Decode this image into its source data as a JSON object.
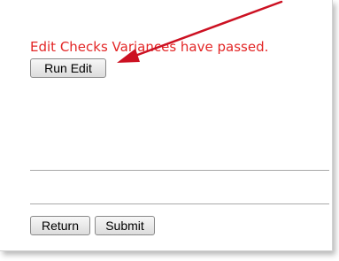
{
  "status_message": "Edit Checks Variances have passed.",
  "buttons": {
    "run_edit": "Run Edit",
    "return": "Return",
    "submit": "Submit"
  },
  "colors": {
    "status_text": "#e32626",
    "annotation_arrow": "#cc1122"
  }
}
